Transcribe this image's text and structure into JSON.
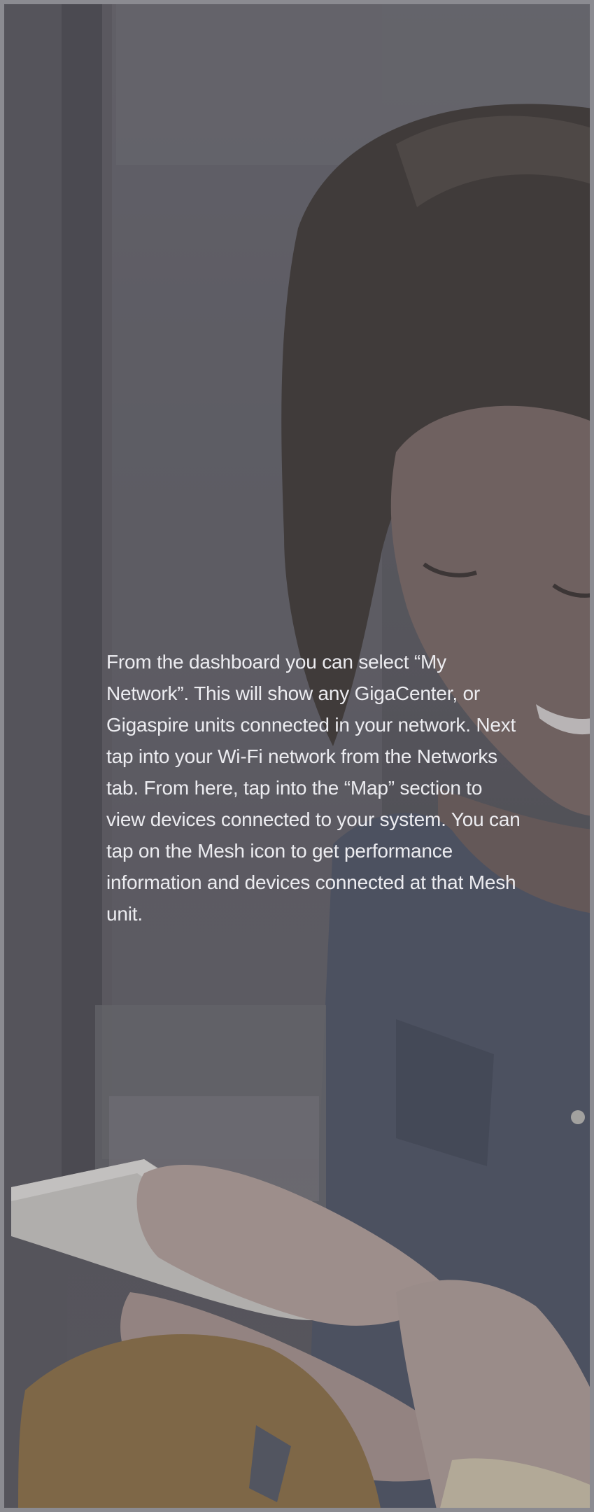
{
  "screen": {
    "background_image": "woman-smiling-using-phone-photo",
    "overlay_color": "#46464e",
    "body_text": "From the dashboard you can select “My Network”. This will show any GigaCenter, or Gigaspire units connected in your network. Next tap into your Wi-Fi network from the Networks tab. From here, tap into the “Map” section to view devices connected to your system. You can tap on the Mesh icon to get performance information and devices connected at that Mesh unit."
  }
}
